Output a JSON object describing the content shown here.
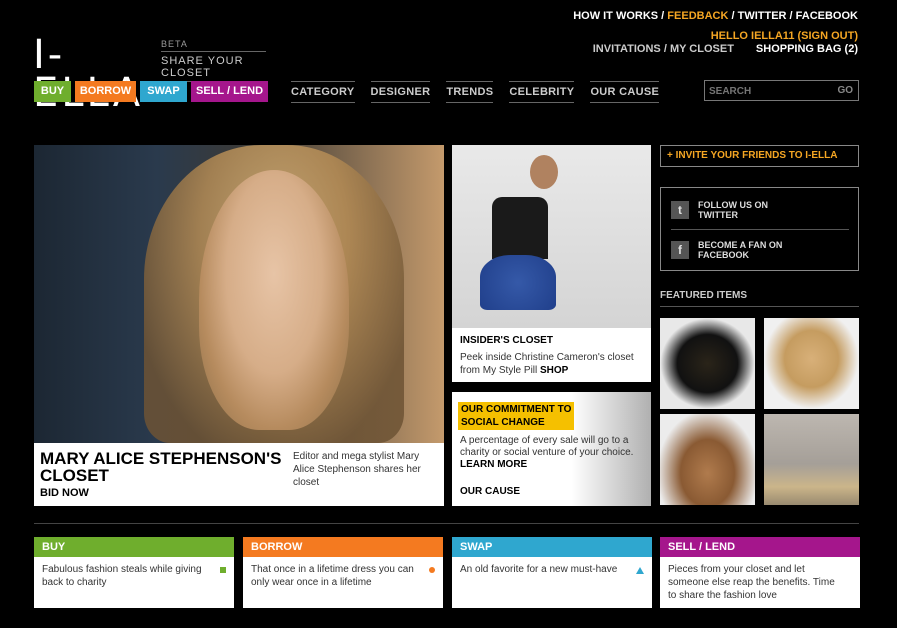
{
  "brand": {
    "logo": "I-ELLA",
    "beta": "BETA",
    "tagline": "SHARE YOUR CLOSET"
  },
  "top_links": {
    "how_it_works": "HOW IT WORKS",
    "sep1": " / ",
    "feedback": "FEEDBACK",
    "sep2": " / ",
    "twitter": "TWITTER",
    "sep3": " / ",
    "facebook": "FACEBOOK"
  },
  "user": {
    "greeting": "HELLO IELLA11 (SIGN OUT)",
    "invitations": "INVITATIONS / MY CLOSET",
    "shopping_bag": "SHOPPING BAG (2)"
  },
  "mode_buttons": [
    "BUY",
    "BORROW",
    "SWAP",
    "SELL / LEND"
  ],
  "nav": [
    "CATEGORY",
    "DESIGNER",
    "TRENDS",
    "CELEBRITY",
    "OUR CAUSE"
  ],
  "search": {
    "placeholder": "SEARCH",
    "go": "GO"
  },
  "hero": {
    "title": "MARY ALICE STEPHENSON'S CLOSET",
    "cta": "BID NOW",
    "description": "Editor and mega stylist Mary Alice Stephenson shares her closet"
  },
  "insider": {
    "title": "INSIDER'S CLOSET",
    "description": "Peek inside Christine Cameron's closet from My Style Pill",
    "link": "SHOP"
  },
  "commitment": {
    "badge_line1": "OUR COMMITMENT TO",
    "badge_line2": "SOCIAL CHANGE",
    "description": "A percentage of every sale will go to a charity or social venture of your choice.",
    "learn_more": "LEARN MORE",
    "link": "OUR CAUSE"
  },
  "sidebar": {
    "invite": "+ INVITE YOUR FRIENDS TO I-ELLA",
    "twitter_label_1": "FOLLOW US ON",
    "twitter_label_2": "TWITTER",
    "facebook_label_1": "BECOME A FAN ON",
    "facebook_label_2": "FACEBOOK",
    "featured_title": "FEATURED ITEMS"
  },
  "cards": [
    {
      "title": "BUY",
      "body": "Fabulous fashion steals while giving back to charity"
    },
    {
      "title": "BORROW",
      "body": "That once in a lifetime dress you can only wear once in a lifetime"
    },
    {
      "title": "SWAP",
      "body": "An old favorite for a new must-have"
    },
    {
      "title": "SELL / LEND",
      "body": "Pieces from your closet and let someone else reap the benefits. Time to share the fashion love"
    }
  ],
  "colors": {
    "buy": "#6fae2d",
    "borrow": "#f47a20",
    "swap": "#2fa7cf",
    "sell": "#a5168c",
    "accent": "#f5a623",
    "commitment": "#f5c000"
  },
  "icons": {
    "twitter": "twitter-icon",
    "facebook": "facebook-icon"
  }
}
